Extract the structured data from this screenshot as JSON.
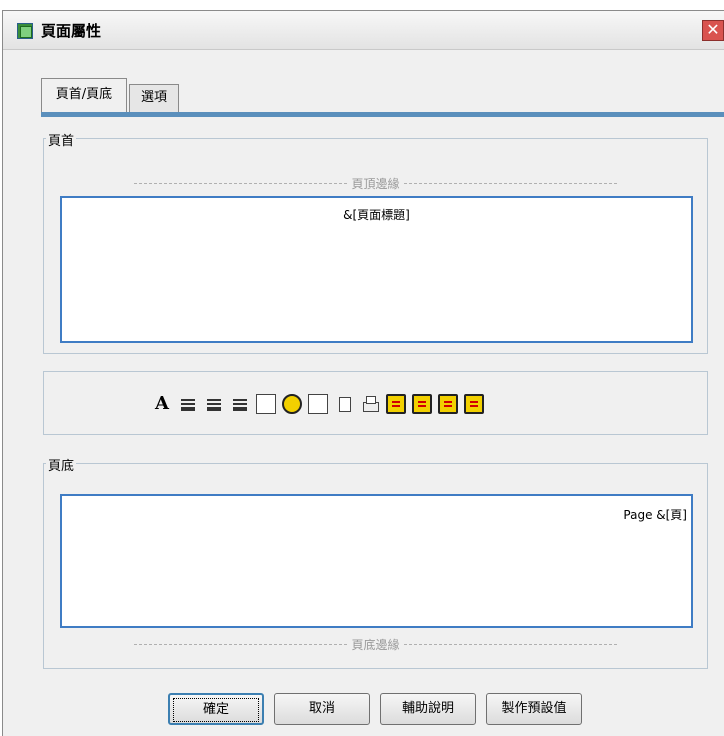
{
  "window": {
    "title": "頁面屬性",
    "close_label": "✕"
  },
  "tabs": [
    {
      "label": "頁首/頁底"
    },
    {
      "label": "選項"
    }
  ],
  "header_group": {
    "label": "頁首",
    "margin_label": "頁頂邊緣",
    "content": "&[頁面標題]"
  },
  "toolbar": {
    "icons": [
      "font-icon",
      "align-left-icon",
      "align-center-icon",
      "align-right-icon",
      "date-icon",
      "time-icon",
      "page-number-icon",
      "file-icon",
      "printer-icon",
      "insert-icon-1",
      "insert-icon-2",
      "insert-icon-3",
      "insert-icon-4"
    ]
  },
  "footer_group": {
    "label": "頁底",
    "margin_label": "頁底邊緣",
    "content": "Page &[頁]"
  },
  "buttons": {
    "ok": "確定",
    "cancel": "取消",
    "help": "輔助說明",
    "make_default": "製作預設值"
  }
}
